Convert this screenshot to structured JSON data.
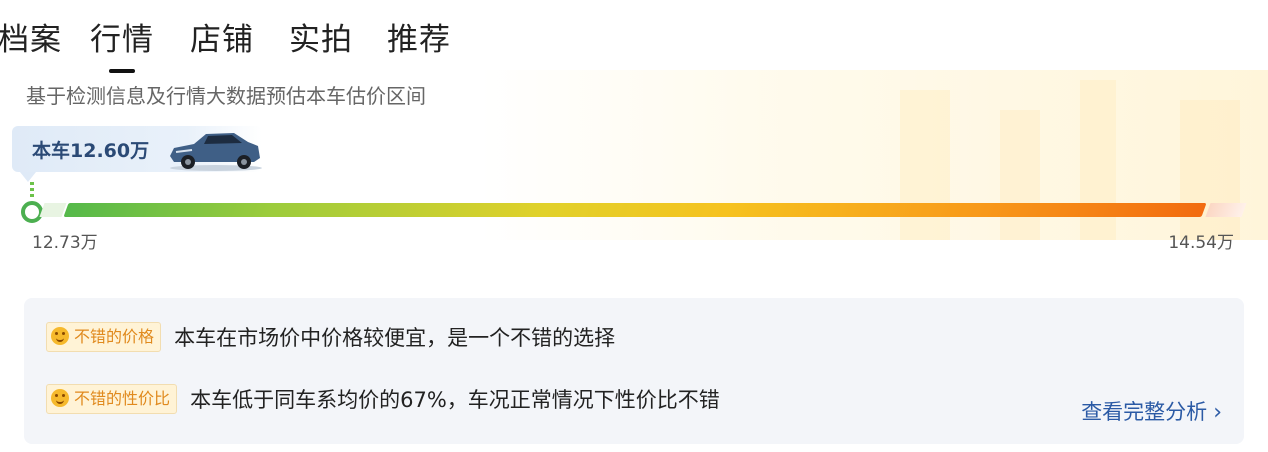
{
  "tabs": [
    {
      "label": "档案"
    },
    {
      "label": "行情"
    },
    {
      "label": "店铺"
    },
    {
      "label": "实拍"
    },
    {
      "label": "推荐"
    }
  ],
  "active_tab": "行情",
  "estimate": {
    "subtitle": "基于检测信息及行情大数据预估本车估价区间",
    "this_car_price": "本车12.60万",
    "range_min": "12.73万",
    "range_max": "14.54万"
  },
  "evaluations": [
    {
      "tag": "不错的价格",
      "text": "本车在市场价中价格较便宜，是一个不错的选择"
    },
    {
      "tag": "不错的性价比",
      "text": "本车低于同车系均价的67%，车况正常情况下性价比不错"
    }
  ],
  "more_link": "查看完整分析",
  "icons": {
    "tag_icon": "smile-face-icon",
    "link_icon": "chevron-right-icon"
  },
  "colors": {
    "bar_start": "#55b94a",
    "bar_mid": "#f6c21f",
    "bar_end": "#f26b10",
    "tag_bg": "#fff3d6",
    "tag_text": "#e08a1e",
    "link": "#2b5aa5"
  }
}
